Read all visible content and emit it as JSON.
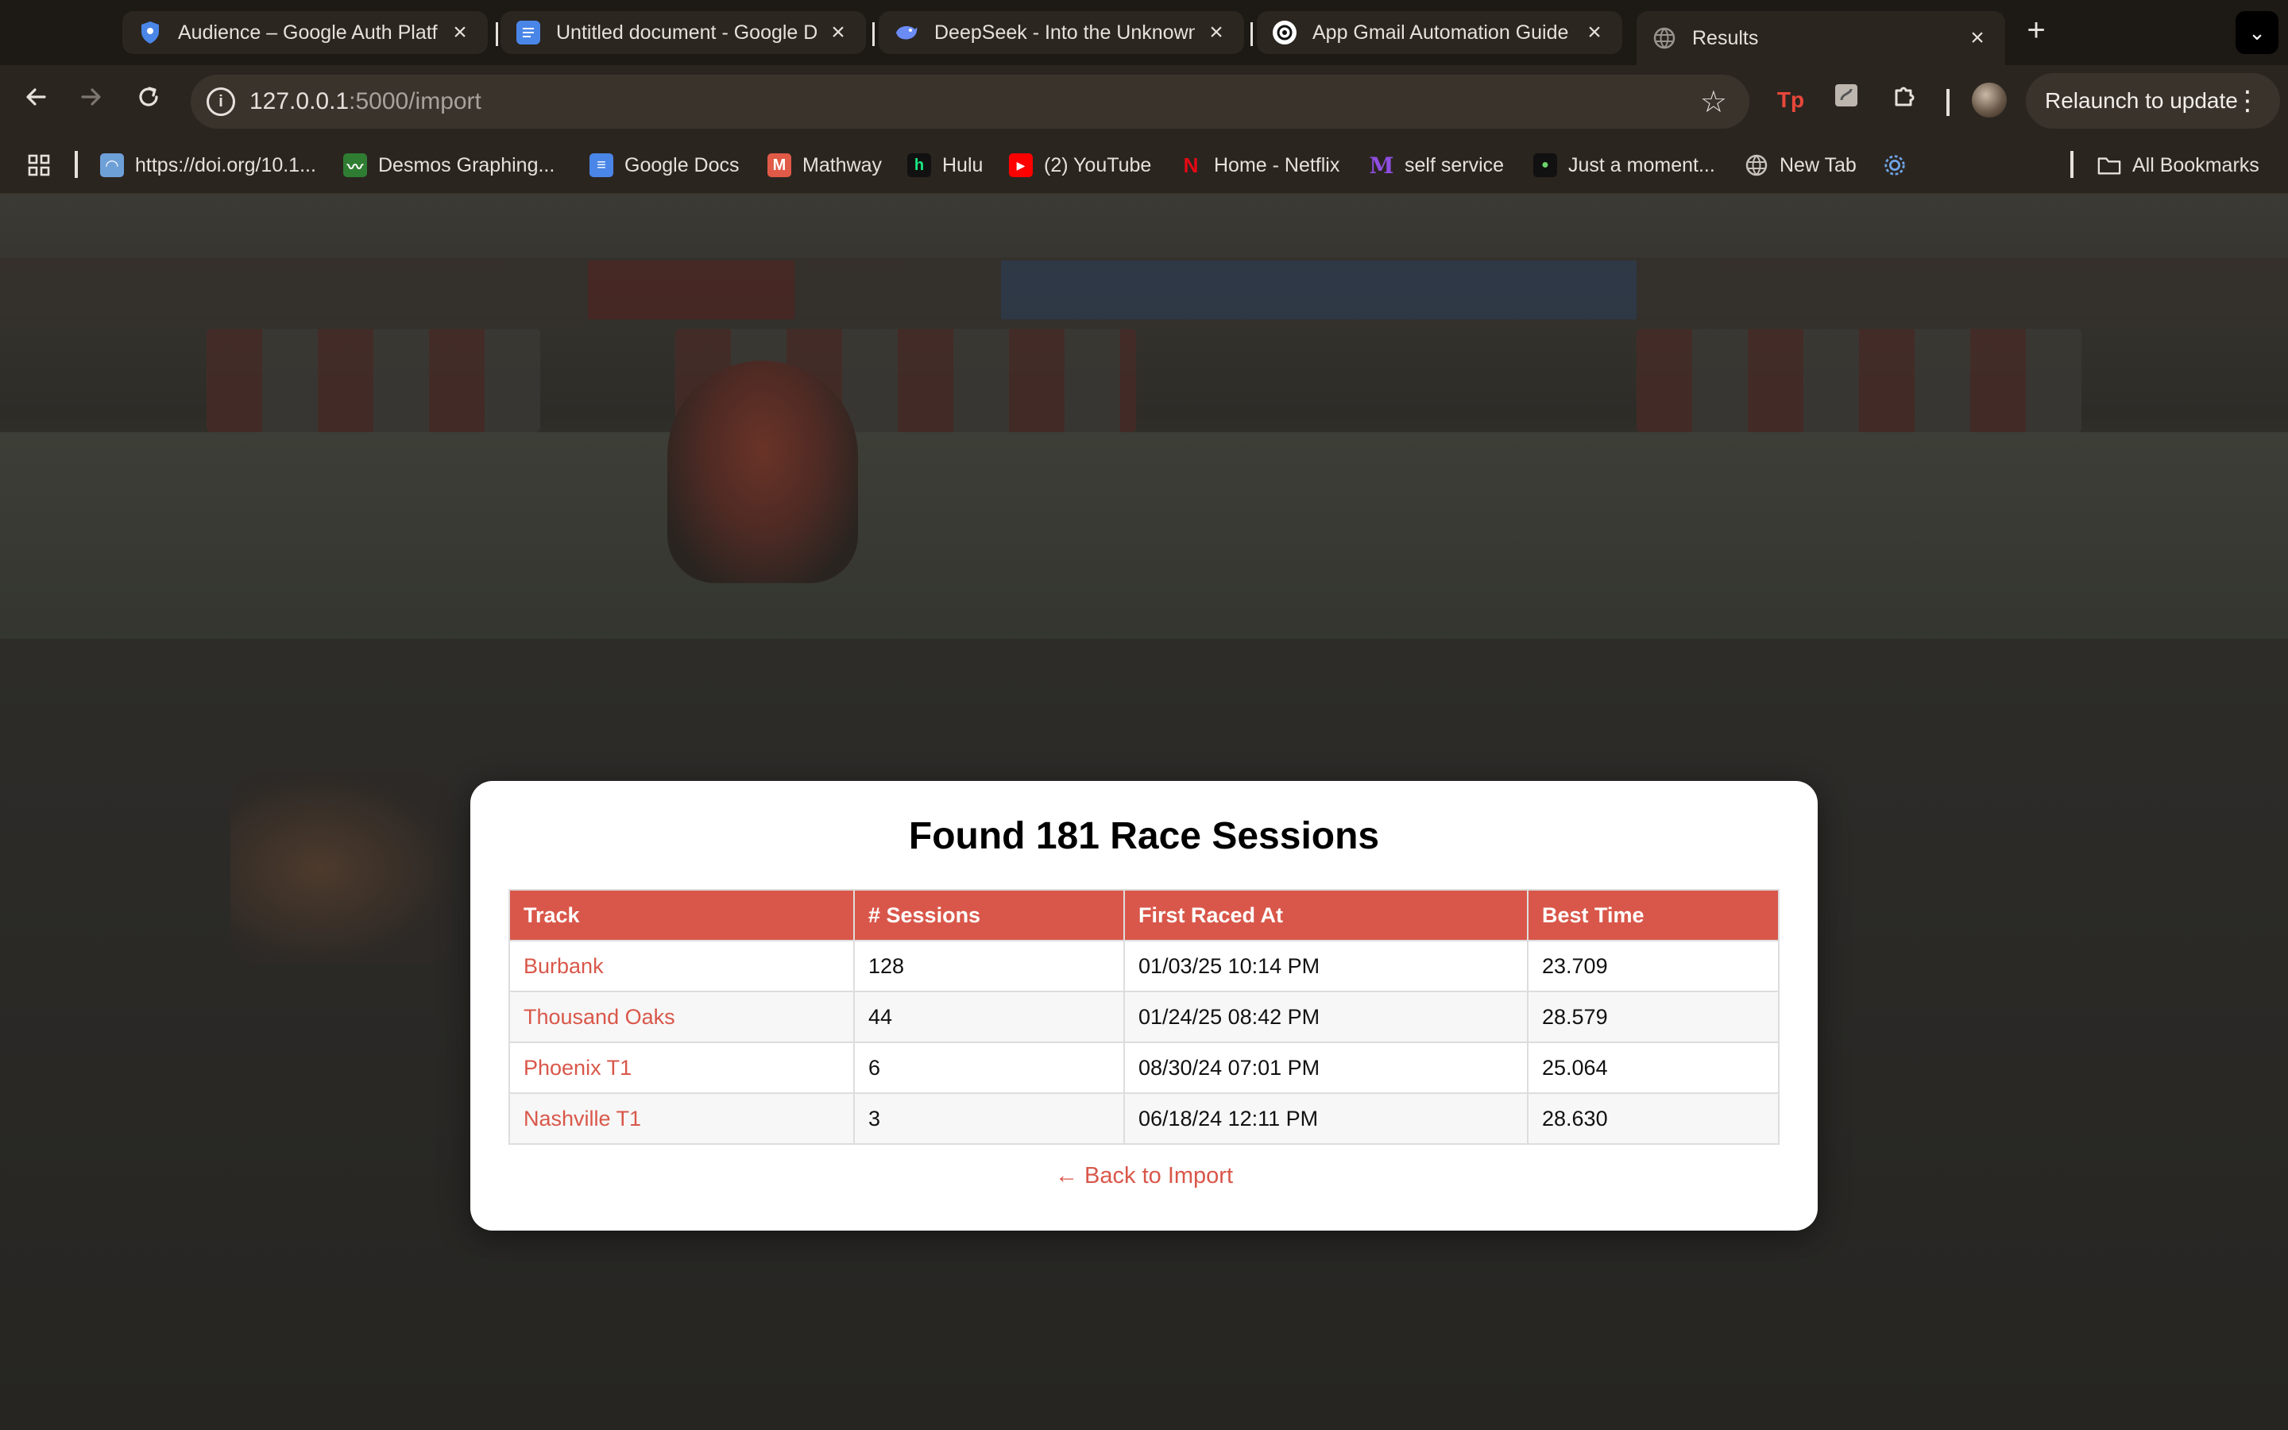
{
  "browser": {
    "tabs": [
      {
        "title": "Audience – Google Auth Platf",
        "icon": "shield-icon"
      },
      {
        "title": "Untitled document - Google D",
        "icon": "docs-icon"
      },
      {
        "title": "DeepSeek - Into the Unknown",
        "icon": "deepseek-icon"
      },
      {
        "title": "App Gmail Automation Guide",
        "icon": "chatgpt-icon"
      },
      {
        "title": "Results",
        "icon": "globe-icon",
        "active": true
      }
    ],
    "url_host": "127.0.0.1",
    "url_path": ":5000/import",
    "relaunch_label": "Relaunch to update",
    "bookmarks": [
      {
        "label": "https://doi.org/10.1...",
        "icon": "doi-icon"
      },
      {
        "label": "Desmos Graphing...",
        "icon": "desmos-icon"
      },
      {
        "label": "Google Docs",
        "icon": "docs-icon"
      },
      {
        "label": "Mathway",
        "icon": "mathway-icon"
      },
      {
        "label": "Hulu",
        "icon": "hulu-icon"
      },
      {
        "label": "(2) YouTube",
        "icon": "youtube-icon"
      },
      {
        "label": "Home - Netflix",
        "icon": "netflix-icon"
      },
      {
        "label": "self service",
        "icon": "m-icon"
      },
      {
        "label": "Just a moment...",
        "icon": "cloud-icon"
      },
      {
        "label": "New Tab",
        "icon": "globe-icon"
      }
    ],
    "all_bookmarks_label": "All Bookmarks"
  },
  "results": {
    "heading": "Found 181 Race Sessions",
    "columns": [
      "Track",
      "# Sessions",
      "First Raced At",
      "Best Time"
    ],
    "rows": [
      {
        "track": "Burbank",
        "sessions": "128",
        "first_raced": "01/03/25 10:14 PM",
        "best_time": "23.709"
      },
      {
        "track": "Thousand Oaks",
        "sessions": "44",
        "first_raced": "01/24/25 08:42 PM",
        "best_time": "28.579"
      },
      {
        "track": "Phoenix T1",
        "sessions": "6",
        "first_raced": "08/30/24 07:01 PM",
        "best_time": "25.064"
      },
      {
        "track": "Nashville T1",
        "sessions": "3",
        "first_raced": "06/18/24 12:11 PM",
        "best_time": "28.630"
      }
    ],
    "back_link": "← Back to Import"
  },
  "colors": {
    "accent": "#d9574a",
    "card_bg": "#ffffff",
    "chrome_bg": "#2b2520"
  }
}
